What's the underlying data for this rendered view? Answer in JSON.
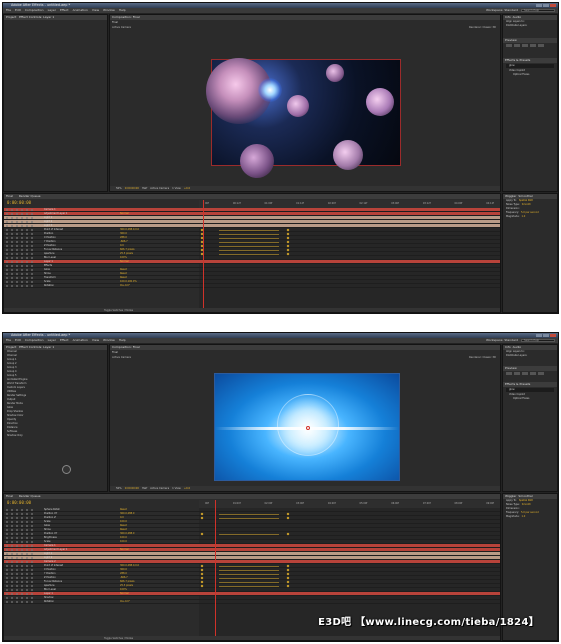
{
  "window_title": "Adobe After Effects - untitled.aep *",
  "menu": [
    "File",
    "Edit",
    "Composition",
    "Layer",
    "Effect",
    "Animation",
    "View",
    "Window",
    "Help"
  ],
  "workspace_label": "Workspace:",
  "workspace_value": "Standard",
  "search_placeholder": "Search Help",
  "left_panel_tabs": [
    "Project",
    "Effect Controls: Layer 1"
  ],
  "viewer_tab": "Composition: Final",
  "viewer_sub": "Final",
  "active_camera": "Active Camera",
  "renderer_label": "Renderer:",
  "renderer_value": "Classic 3D",
  "viewer_controls": {
    "zoom": "50%",
    "timecode": "0:00:00:00",
    "resolution": "Half",
    "view": "Active Camera",
    "views": "1 View",
    "exposure": "+0.0"
  },
  "timeline_tabs": [
    "Final",
    "Render Queue"
  ],
  "timeline_timecode": "0:00:00:00",
  "ruler_ticks": [
    "00f",
    "00:12f",
    "01:00f",
    "01:12f",
    "02:00f",
    "02:12f",
    "03:00f",
    "03:12f",
    "04:00f",
    "04:12f",
    "05:00f",
    "05:12f",
    "06:00f",
    "06:12f",
    "07:00f",
    "07:12f",
    "08:00f",
    "08:12f",
    "09:00f",
    "09:12f"
  ],
  "column_headers": [
    "Source Name",
    "Mode",
    "T TrkMat",
    "Parent"
  ],
  "shot1_layers": [
    {
      "name": "Camera 1",
      "value": ""
    },
    {
      "name": "Adjustment Layer 1",
      "value": "Normal"
    },
    {
      "name": "Light 1",
      "value": ""
    },
    {
      "name": "Light 2",
      "value": ""
    },
    {
      "name": "Light 3",
      "value": ""
    },
    {
      "name": "Point of Interest",
      "value": "360.0,288.0,0.0"
    },
    {
      "name": "Position",
      "value": "360.0"
    },
    {
      "name": "X Position",
      "value": "288.0"
    },
    {
      "name": "Y Position",
      "value": "-666.7"
    },
    {
      "name": "Z Position",
      "value": "0.0"
    },
    {
      "name": "Focus Distance",
      "value": "666.7 pixels"
    },
    {
      "name": "Aperture",
      "value": "25.3 pixels"
    },
    {
      "name": "Blur Level",
      "value": "100%"
    },
    {
      "name": "Layer 1",
      "value": "Normal"
    },
    {
      "name": "Effects",
      "value": ""
    },
    {
      "name": "Glow",
      "value": "Reset"
    },
    {
      "name": "Shine",
      "value": "Reset"
    },
    {
      "name": "Transform",
      "value": "Reset"
    },
    {
      "name": "Scale",
      "value": "100.0,100.0%"
    },
    {
      "name": "Rotation",
      "value": "0x+0.0°"
    }
  ],
  "shot2_left_items": [
    "Channel",
    "Channel",
    "Group 1",
    "Group 2",
    "Group 3",
    "Group 4",
    "Group 5",
    "Animated Engine",
    "World Transform",
    "Custom Layers",
    "Utilities",
    "Render Settings",
    "Output",
    "Render Mode",
    "Glow",
    "Drop Shadow",
    "Shadow Color",
    "Opacity",
    "Direction",
    "Distance",
    "Softness",
    "Shadow Only"
  ],
  "shot2_layers": [
    {
      "name": "Sphere Rotat",
      "value": "Reset"
    },
    {
      "name": "Position XY",
      "value": "360.0,288.0"
    },
    {
      "name": "Position Z",
      "value": "0.0"
    },
    {
      "name": "Scale",
      "value": "100.0"
    },
    {
      "name": "Glow",
      "value": "Reset"
    },
    {
      "name": "Shine",
      "value": "Reset"
    },
    {
      "name": "Position XY",
      "value": "360.0,288.0"
    },
    {
      "name": "Brightness",
      "value": "100.0"
    },
    {
      "name": "Scale",
      "value": "100.0"
    },
    {
      "name": "Camera 1",
      "value": ""
    },
    {
      "name": "Adjustment Layer 1",
      "value": "Normal"
    },
    {
      "name": "Light 1",
      "value": ""
    },
    {
      "name": "Light 2",
      "value": ""
    },
    {
      "name": "Camera 2",
      "value": ""
    },
    {
      "name": "Point of Interest",
      "value": "360.0,288.0,0.0"
    },
    {
      "name": "X Position",
      "value": "360.0"
    },
    {
      "name": "Y Position",
      "value": "288.0"
    },
    {
      "name": "Z Position",
      "value": "-666.7"
    },
    {
      "name": "Focus Distance",
      "value": "666.7 pixels"
    },
    {
      "name": "Aperture",
      "value": "25.3 pixels"
    },
    {
      "name": "Blur Level",
      "value": "100%"
    },
    {
      "name": "Layer 1",
      "value": "Normal"
    },
    {
      "name": "Shadow",
      "value": ""
    },
    {
      "name": "Rotation",
      "value": "0x+0.0°"
    }
  ],
  "right_panels": {
    "info_tab": "Info",
    "audio_tab": "Audio",
    "preview_tab": "Preview",
    "effects_tab": "Effects & Presets",
    "effects_search": "glow",
    "effects_items": [
      "Video Copilot",
      "Optical Flares"
    ],
    "paragraph_items": [
      "Align Layers to:",
      "Distribute Layers:"
    ],
    "wiggler_tab": "Wiggler",
    "smoother_tab": "Smoother",
    "wiggler_items": [
      "Apply To:",
      "Noise Type:",
      "Dimension:",
      "Frequency:",
      "Magnitude:"
    ],
    "wiggler_values": [
      "Spatial Path",
      "Smooth",
      "",
      "5.0 per second",
      "1.0"
    ]
  },
  "footer_toggle": "Toggle Switches / Modes",
  "watermark": "E3D吧 【www.linecg.com/tieba/1824】",
  "colors": {
    "accent": "#e1b02c",
    "playhead": "#d0322a",
    "layer_red": "#b8433a",
    "layer_tan": "#b99b87",
    "layer_blue": "#8a8fb8"
  }
}
